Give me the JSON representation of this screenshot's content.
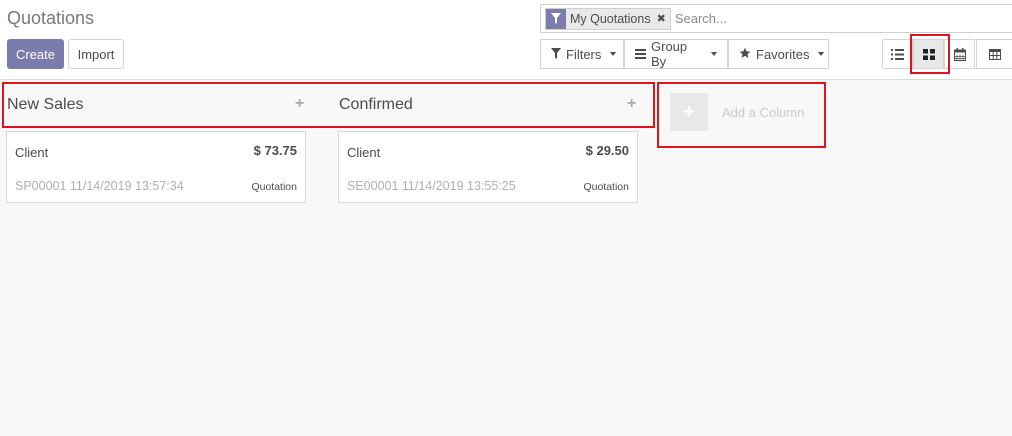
{
  "header": {
    "title": "Quotations"
  },
  "actions": {
    "create_label": "Create",
    "import_label": "Import"
  },
  "search": {
    "facet_label": "My Quotations",
    "facet_remove_icon": "✖",
    "placeholder": "Search..."
  },
  "dropdowns": {
    "filters": "Filters",
    "group_by": "Group By",
    "favorites": "Favorites"
  },
  "view_switcher": {
    "views": [
      "list",
      "kanban",
      "calendar",
      "pivot"
    ],
    "active": "kanban"
  },
  "kanban": {
    "columns": [
      {
        "title": "New Sales",
        "add_icon": "+",
        "cards": [
          {
            "client": "Client",
            "amount": "$ 73.75",
            "ref": "SP00001 11/14/2019 13:57:34",
            "status": "Quotation"
          }
        ]
      },
      {
        "title": "Confirmed",
        "add_icon": "+",
        "cards": [
          {
            "client": "Client",
            "amount": "$ 29.50",
            "ref": "SE00001 11/14/2019 13:55:25",
            "status": "Quotation"
          }
        ]
      }
    ],
    "add_column": {
      "icon": "+",
      "label": "Add a Column"
    }
  },
  "colors": {
    "primary": "#7c7bad",
    "highlight": "#e0141e",
    "background": "#f8f8f8"
  }
}
